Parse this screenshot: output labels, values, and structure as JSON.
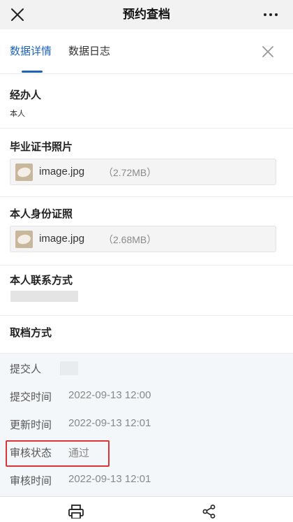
{
  "app": {
    "title": "预约查档"
  },
  "tabs": [
    {
      "label": "数据详情",
      "active": true
    },
    {
      "label": "数据日志",
      "active": false
    }
  ],
  "fields": {
    "handler": {
      "label": "经办人",
      "value": "本人"
    },
    "diploma_photo": {
      "label": "毕业证书照片",
      "file_name": "image.jpg",
      "file_size": "（2.72MB）"
    },
    "id_photo": {
      "label": "本人身份证照",
      "file_name": "image.jpg",
      "file_size": "（2.68MB）"
    },
    "contact": {
      "label": "本人联系方式"
    },
    "pickup_method": {
      "label": "取档方式"
    }
  },
  "meta": {
    "submitter_label": "提交人",
    "submit_time_label": "提交时间",
    "submit_time": "2022-09-13 12:00",
    "update_time_label": "更新时间",
    "update_time": "2022-09-13 12:01",
    "review_status_label": "审核状态",
    "review_status": "通过",
    "review_time_label": "审核时间",
    "review_time": "2022-09-13 12:01"
  },
  "colors": {
    "accent": "#1f63b8",
    "highlight_border": "#d9363a"
  },
  "icons": {
    "top_close": "close-icon",
    "top_more": "more-icon",
    "panel_close": "close-icon",
    "file_thumb": "image-thumbnail-icon",
    "bottom_print": "printer-icon",
    "bottom_share": "share-icon"
  }
}
